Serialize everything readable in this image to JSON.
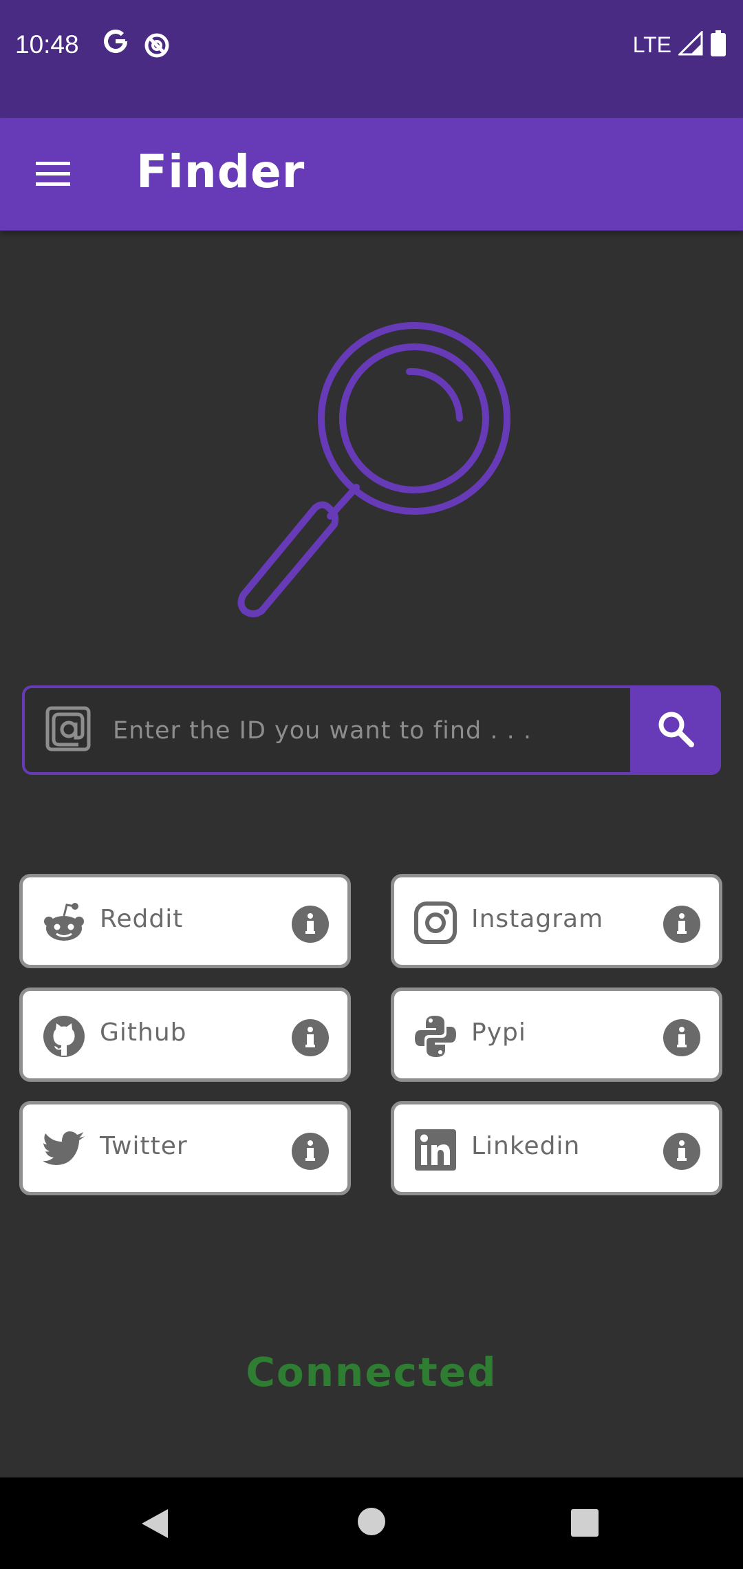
{
  "status_bar": {
    "time": "10:48",
    "network": "LTE",
    "icons": [
      "google-g-icon",
      "at-sign-status-icon",
      "signal-icon",
      "battery-icon"
    ]
  },
  "app_bar": {
    "title": "Finder",
    "menu_icon": "hamburger-menu-icon"
  },
  "hero": {
    "icon": "magnifying-glass-icon"
  },
  "search": {
    "placeholder": "Enter the ID you want to find . . .",
    "value": "",
    "prefix_icon": "at-sign-icon",
    "button_icon": "search-icon"
  },
  "platforms": [
    {
      "label": "Reddit",
      "icon": "reddit-icon"
    },
    {
      "label": "Instagram",
      "icon": "instagram-icon"
    },
    {
      "label": "Github",
      "icon": "github-icon"
    },
    {
      "label": "Pypi",
      "icon": "python-icon"
    },
    {
      "label": "Twitter",
      "icon": "twitter-icon"
    },
    {
      "label": "Linkedin",
      "icon": "linkedin-icon"
    }
  ],
  "status": {
    "text": "Connected"
  },
  "colors": {
    "primary": "#673ab7",
    "status_bar": "#4a2b84",
    "background": "#303030",
    "connected": "#2e7d32",
    "card_border": "#8f8f8f",
    "icon_gray": "#6a6a6a"
  },
  "nav_bar": {
    "icons": [
      "back-icon",
      "home-icon",
      "recents-icon"
    ]
  }
}
